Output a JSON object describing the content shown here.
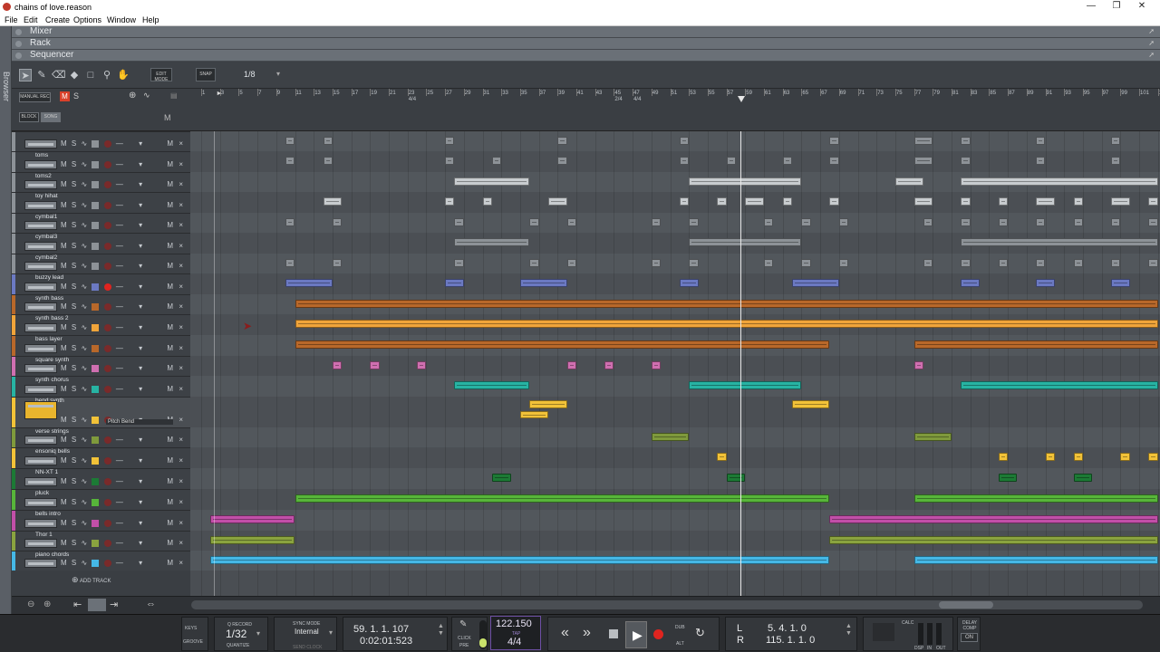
{
  "window": {
    "title": "chains of love.reason"
  },
  "menu": [
    "File",
    "Edit",
    "Create",
    "Options",
    "Window",
    "Help"
  ],
  "side_label": "Browser",
  "folds": [
    "Mixer",
    "Rack",
    "Sequencer"
  ],
  "toolbar": {
    "edit_mode": "EDIT MODE",
    "snap": "SNAP",
    "snap_value": "1/8"
  },
  "header": {
    "manual_rec": "MANUAL REC",
    "m": "M",
    "s": "S",
    "block": "BLOCK",
    "song": "SONG",
    "m2": "M",
    "add_track": "ADD TRACK"
  },
  "ruler": {
    "bars": [
      "1",
      "3",
      "5",
      "7",
      "9",
      "11",
      "13",
      "15",
      "17",
      "19",
      "21",
      "23",
      "25",
      "27",
      "29",
      "31",
      "33",
      "35",
      "37",
      "39",
      "41",
      "43",
      "45",
      "47",
      "49",
      "51",
      "53",
      "55",
      "57",
      "59",
      "61",
      "63",
      "65",
      "67",
      "69",
      "71",
      "73",
      "75",
      "77",
      "79",
      "81",
      "83",
      "85",
      "87",
      "89",
      "91",
      "93",
      "95",
      "97",
      "99",
      "101",
      "103",
      "105"
    ],
    "sig_marks": [
      "4/4",
      "2/4",
      "4/4"
    ]
  },
  "colors": {
    "kick": "#8d9297",
    "gray": "#8d9297",
    "blue": "#6b79c2",
    "brown": "#b8682a",
    "orange": "#f0a43a",
    "pink": "#cf6fb0",
    "teal": "#27b3a3",
    "yellow": "#f2c238",
    "olive": "#7f9a3c",
    "darkgreen": "#1c7a35",
    "green": "#57b53a",
    "magenta": "#c14fa8",
    "thor": "#8aa33f",
    "cyan": "#45b8e6"
  },
  "tracks": [
    {
      "name": "",
      "color": "#8d9297"
    },
    {
      "name": "toms",
      "color": "#8d9297"
    },
    {
      "name": "toms2",
      "color": "#8d9297"
    },
    {
      "name": "toy hihat",
      "color": "#8d9297"
    },
    {
      "name": "cymbal1",
      "color": "#8d9297"
    },
    {
      "name": "cymbal3",
      "color": "#8d9297"
    },
    {
      "name": "cymbal2",
      "color": "#8d9297"
    },
    {
      "name": "buzzy lead",
      "color": "#6b79c2"
    },
    {
      "name": "synth bass",
      "color": "#b8682a"
    },
    {
      "name": "synth bass 2",
      "color": "#f0a43a"
    },
    {
      "name": "bass layer",
      "color": "#b8682a"
    },
    {
      "name": "square synth",
      "color": "#cf6fb0"
    },
    {
      "name": "synth chorus",
      "color": "#27b3a3"
    },
    {
      "name": "bend synth",
      "color": "#f2c238",
      "sub": "Pitch Bend"
    },
    {
      "name": "verse strings",
      "color": "#7f9a3c"
    },
    {
      "name": "ensoniq bells",
      "color": "#f2c238"
    },
    {
      "name": "NN-XT 1",
      "color": "#1c7a35"
    },
    {
      "name": "pluck",
      "color": "#57b53a"
    },
    {
      "name": "bells intro",
      "color": "#c14fa8"
    },
    {
      "name": "Thor 1",
      "color": "#8aa33f"
    },
    {
      "name": "piano chords",
      "color": "#45b8e6"
    }
  ],
  "track_ctrl": {
    "m": "M",
    "s": "S",
    "x": "×"
  },
  "transport": {
    "keys": "KEYS",
    "groove": "GROOVE",
    "q_record": "Q RECORD",
    "quantize_value": "1/32",
    "quantize": "QUANTIZE",
    "sync_mode": "SYNC MODE",
    "sync_value": "Internal",
    "send_clock": "SEND CLOCK",
    "position_bars": "59.  1.  1. 107",
    "position_time": "0:02:01:523",
    "click": "CLICK",
    "pre": "PRE",
    "tempo": "122.150",
    "tap": "TAP",
    "signature": "4/4",
    "dub": "DUB",
    "alt": "ALT",
    "loop_l_label": "L",
    "loop_l": "5.  4.  1.    0",
    "loop_r_label": "R",
    "loop_r": "115.  1.  1.    0",
    "calc": "CALC",
    "dsp": "DSP",
    "in": "IN",
    "out": "OUT",
    "delay_comp": "DELAY COMP",
    "on": "ON"
  }
}
